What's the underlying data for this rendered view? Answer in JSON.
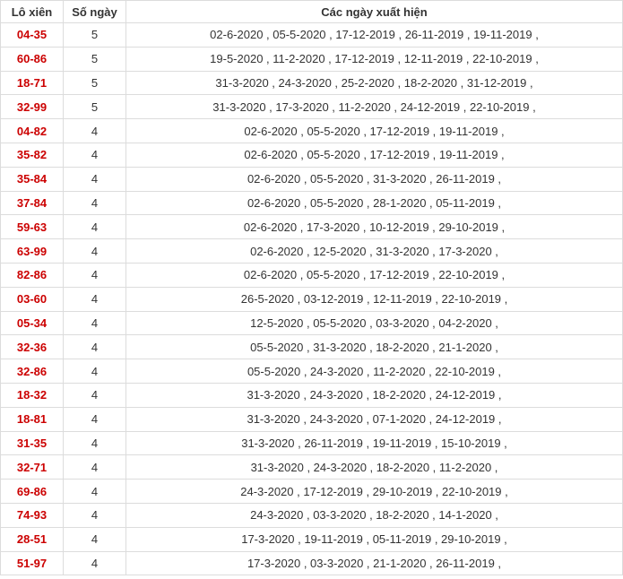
{
  "table": {
    "headers": [
      "Lô xiên",
      "Số ngày",
      "Các ngày xuất hiện"
    ],
    "rows": [
      {
        "pair": "04-35",
        "days": "5",
        "dates": "02-6-2020 , 05-5-2020 , 17-12-2019 , 26-11-2019 , 19-11-2019 ,"
      },
      {
        "pair": "60-86",
        "days": "5",
        "dates": "19-5-2020 , 11-2-2020 , 17-12-2019 , 12-11-2019 , 22-10-2019 ,"
      },
      {
        "pair": "18-71",
        "days": "5",
        "dates": "31-3-2020 , 24-3-2020 , 25-2-2020 , 18-2-2020 , 31-12-2019 ,"
      },
      {
        "pair": "32-99",
        "days": "5",
        "dates": "31-3-2020 , 17-3-2020 , 11-2-2020 , 24-12-2019 , 22-10-2019 ,"
      },
      {
        "pair": "04-82",
        "days": "4",
        "dates": "02-6-2020 , 05-5-2020 , 17-12-2019 , 19-11-2019 ,"
      },
      {
        "pair": "35-82",
        "days": "4",
        "dates": "02-6-2020 , 05-5-2020 , 17-12-2019 , 19-11-2019 ,"
      },
      {
        "pair": "35-84",
        "days": "4",
        "dates": "02-6-2020 , 05-5-2020 , 31-3-2020 , 26-11-2019 ,"
      },
      {
        "pair": "37-84",
        "days": "4",
        "dates": "02-6-2020 , 05-5-2020 , 28-1-2020 , 05-11-2019 ,"
      },
      {
        "pair": "59-63",
        "days": "4",
        "dates": "02-6-2020 , 17-3-2020 , 10-12-2019 , 29-10-2019 ,"
      },
      {
        "pair": "63-99",
        "days": "4",
        "dates": "02-6-2020 , 12-5-2020 , 31-3-2020 , 17-3-2020 ,"
      },
      {
        "pair": "82-86",
        "days": "4",
        "dates": "02-6-2020 , 05-5-2020 , 17-12-2019 , 22-10-2019 ,"
      },
      {
        "pair": "03-60",
        "days": "4",
        "dates": "26-5-2020 , 03-12-2019 , 12-11-2019 , 22-10-2019 ,"
      },
      {
        "pair": "05-34",
        "days": "4",
        "dates": "12-5-2020 , 05-5-2020 , 03-3-2020 , 04-2-2020 ,"
      },
      {
        "pair": "32-36",
        "days": "4",
        "dates": "05-5-2020 , 31-3-2020 , 18-2-2020 , 21-1-2020 ,"
      },
      {
        "pair": "32-86",
        "days": "4",
        "dates": "05-5-2020 , 24-3-2020 , 11-2-2020 , 22-10-2019 ,"
      },
      {
        "pair": "18-32",
        "days": "4",
        "dates": "31-3-2020 , 24-3-2020 , 18-2-2020 , 24-12-2019 ,"
      },
      {
        "pair": "18-81",
        "days": "4",
        "dates": "31-3-2020 , 24-3-2020 , 07-1-2020 , 24-12-2019 ,"
      },
      {
        "pair": "31-35",
        "days": "4",
        "dates": "31-3-2020 , 26-11-2019 , 19-11-2019 , 15-10-2019 ,"
      },
      {
        "pair": "32-71",
        "days": "4",
        "dates": "31-3-2020 , 24-3-2020 , 18-2-2020 , 11-2-2020 ,"
      },
      {
        "pair": "69-86",
        "days": "4",
        "dates": "24-3-2020 , 17-12-2019 , 29-10-2019 , 22-10-2019 ,"
      },
      {
        "pair": "74-93",
        "days": "4",
        "dates": "24-3-2020 , 03-3-2020 , 18-2-2020 , 14-1-2020 ,"
      },
      {
        "pair": "28-51",
        "days": "4",
        "dates": "17-3-2020 , 19-11-2019 , 05-11-2019 , 29-10-2019 ,"
      },
      {
        "pair": "51-97",
        "days": "4",
        "dates": "17-3-2020 , 03-3-2020 , 21-1-2020 , 26-11-2019 ,"
      }
    ]
  }
}
